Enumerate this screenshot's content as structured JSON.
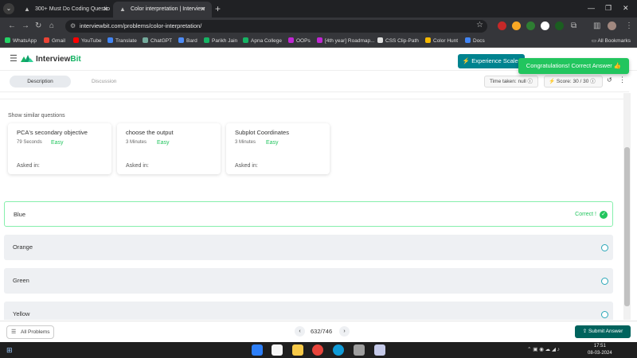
{
  "browser": {
    "tabs": [
      {
        "title": "300+ Must Do Coding Questio",
        "active": false
      },
      {
        "title": "Color interpretation | Interview",
        "active": true
      }
    ],
    "url": "interviewbit.com/problems/color-interpretation/",
    "bookmarks": [
      "WhatsApp",
      "Gmail",
      "YouTube",
      "Translate",
      "ChatGPT",
      "Bard",
      "Parikh Jain",
      "Apna College",
      "OOPs",
      "[4th year] Roadmap...",
      "CSS Clip-Path",
      "Color Hunt",
      "Docs"
    ],
    "all_bookmarks": "All Bookmarks"
  },
  "site": {
    "logo_main": "Interview",
    "logo_accent": "Bit",
    "experience_button": "Experience Scaler",
    "toast": "Congratulations! Correct Answer"
  },
  "problem_tabs": {
    "description": "Description",
    "discussion": "Discussion",
    "time_taken": "Time taken: null",
    "score": "Score: 30 / 30"
  },
  "similar": {
    "title": "Show similar questions",
    "cards": [
      {
        "title": "PCA's secondary objective",
        "time": "79 Seconds",
        "difficulty": "Easy",
        "asked": "Asked in:"
      },
      {
        "title": "choose the output",
        "time": "3 Minutes",
        "difficulty": "Easy",
        "asked": "Asked in:"
      },
      {
        "title": "Subplot Coordinates",
        "time": "3 Minutes",
        "difficulty": "Easy",
        "asked": "Asked in:"
      }
    ]
  },
  "options": [
    {
      "label": "Blue",
      "correct": true,
      "status": "Correct !"
    },
    {
      "label": "Orange",
      "correct": false
    },
    {
      "label": "Green",
      "correct": false
    },
    {
      "label": "Yellow",
      "correct": false
    }
  ],
  "footer": {
    "all_problems": "All Problems",
    "page": "632/746",
    "submit": "Submit Answer"
  },
  "taskbar": {
    "time": "17:51",
    "date": "08-03-2024"
  },
  "colors": {
    "accent_green": "#22c55e",
    "teal": "#00838f",
    "submit_teal": "#00635d"
  }
}
